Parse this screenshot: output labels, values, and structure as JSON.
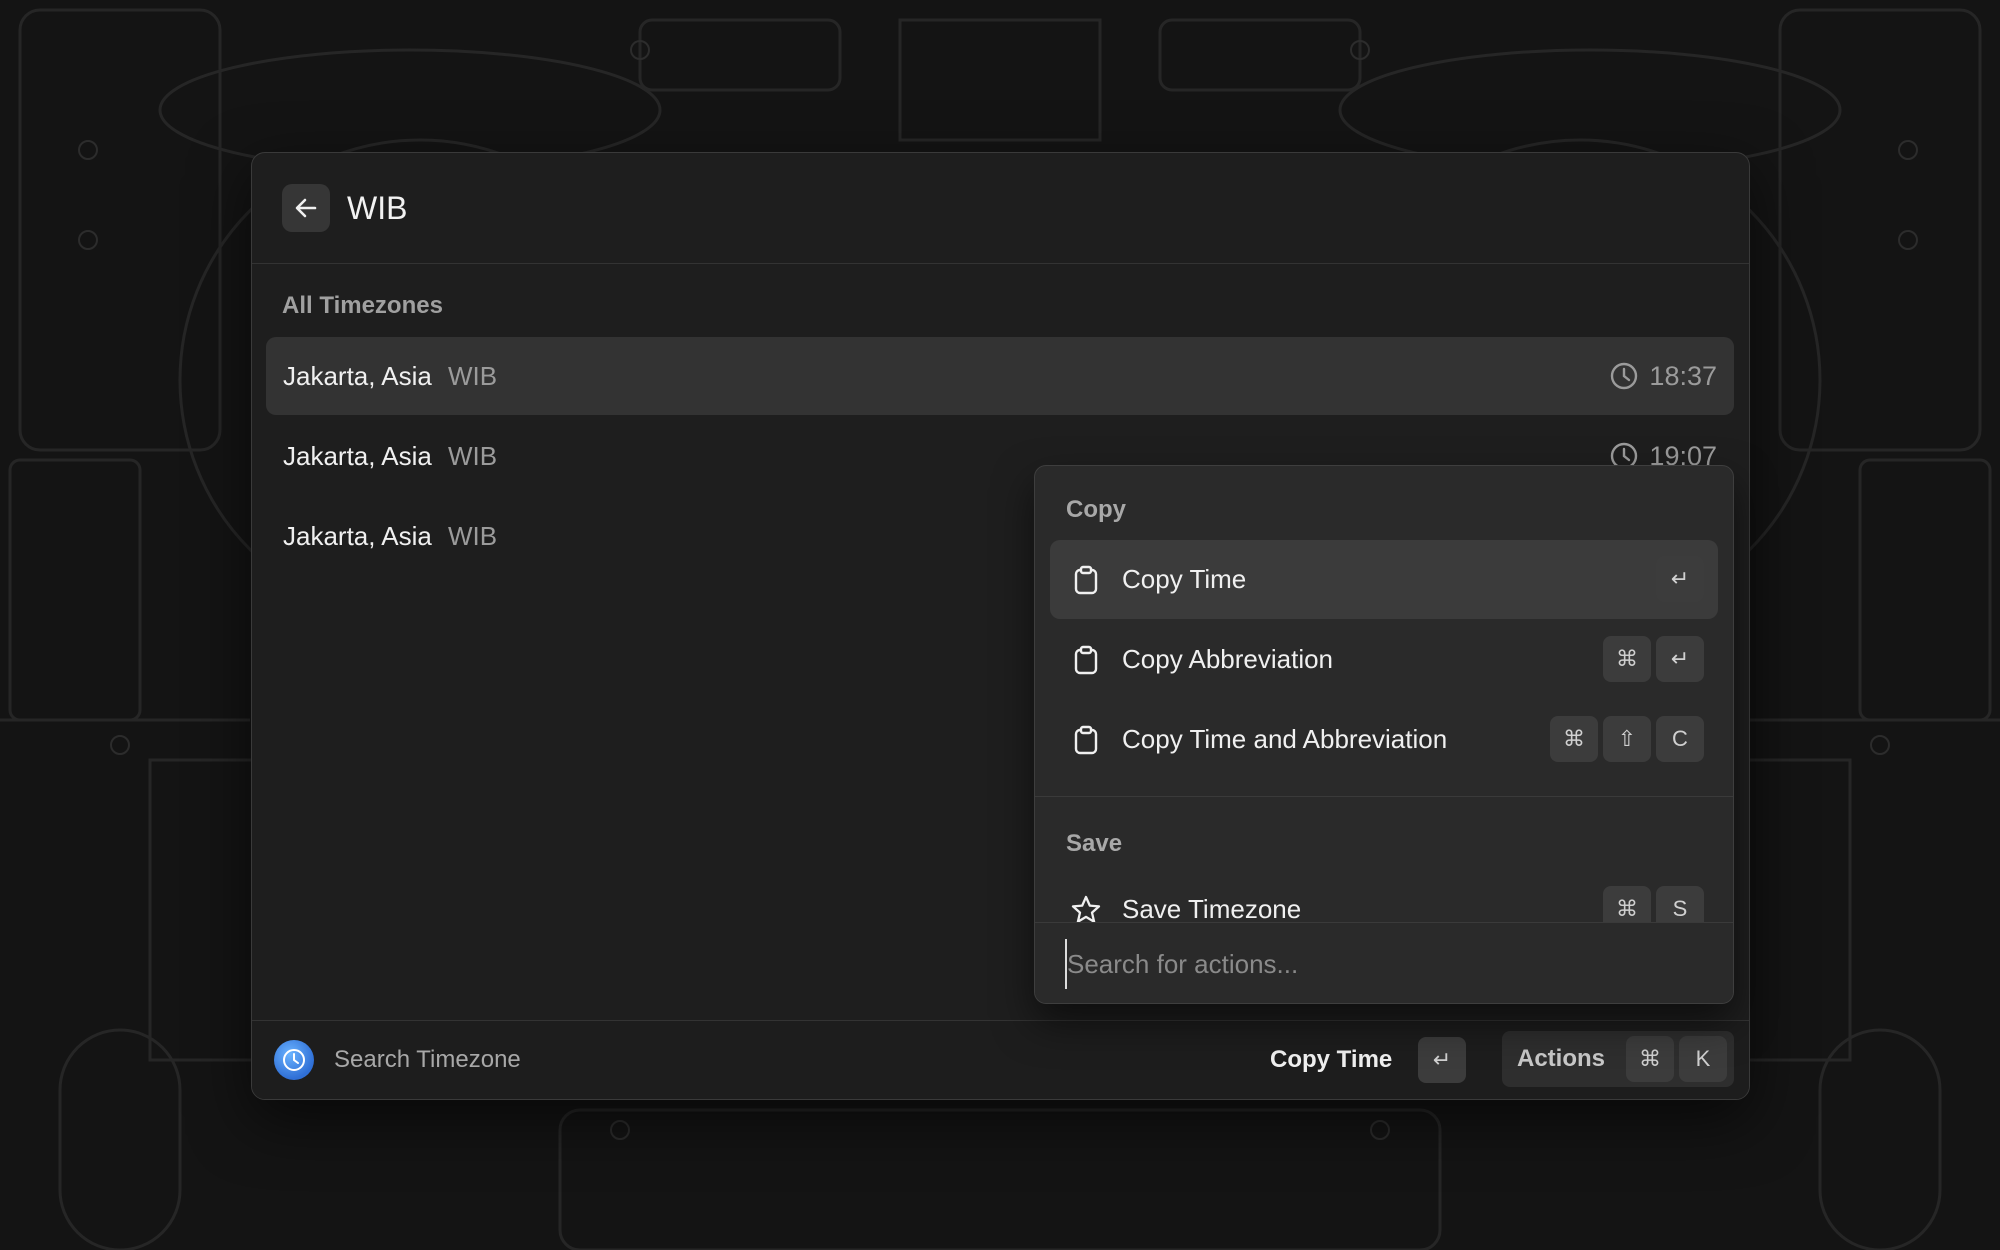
{
  "header": {
    "query": "WIB"
  },
  "list": {
    "section_title": "All Timezones",
    "items": [
      {
        "city": "Jakarta, Asia",
        "abbr": "WIB",
        "time": "18:37"
      },
      {
        "city": "Jakarta, Asia",
        "abbr": "WIB",
        "time": "19:07"
      },
      {
        "city": "Jakarta, Asia",
        "abbr": "WIB",
        "time": ""
      }
    ]
  },
  "footer": {
    "title": "Search Timezone",
    "primary_action": "Copy Time",
    "primary_key": "↵",
    "actions_label": "Actions",
    "actions_keys": [
      "⌘",
      "K"
    ]
  },
  "action_panel": {
    "sections": [
      {
        "title": "Copy",
        "items": [
          {
            "label": "Copy Time",
            "icon": "clipboard-icon",
            "keys": [
              "↵"
            ]
          },
          {
            "label": "Copy Abbreviation",
            "icon": "clipboard-icon",
            "keys": [
              "⌘",
              "↵"
            ]
          },
          {
            "label": "Copy Time and Abbreviation",
            "icon": "clipboard-icon",
            "keys": [
              "⌘",
              "⇧",
              "C"
            ]
          }
        ]
      },
      {
        "title": "Save",
        "items": [
          {
            "label": "Save Timezone",
            "icon": "star-icon",
            "keys": [
              "⌘",
              "S"
            ]
          }
        ]
      }
    ],
    "search_placeholder": "Search for actions..."
  },
  "colors": {
    "window_bg": "#1e1e1e",
    "selected_row": "#333333",
    "panel_bg": "#2a2a2a",
    "app_icon": "#2f6fd6"
  }
}
